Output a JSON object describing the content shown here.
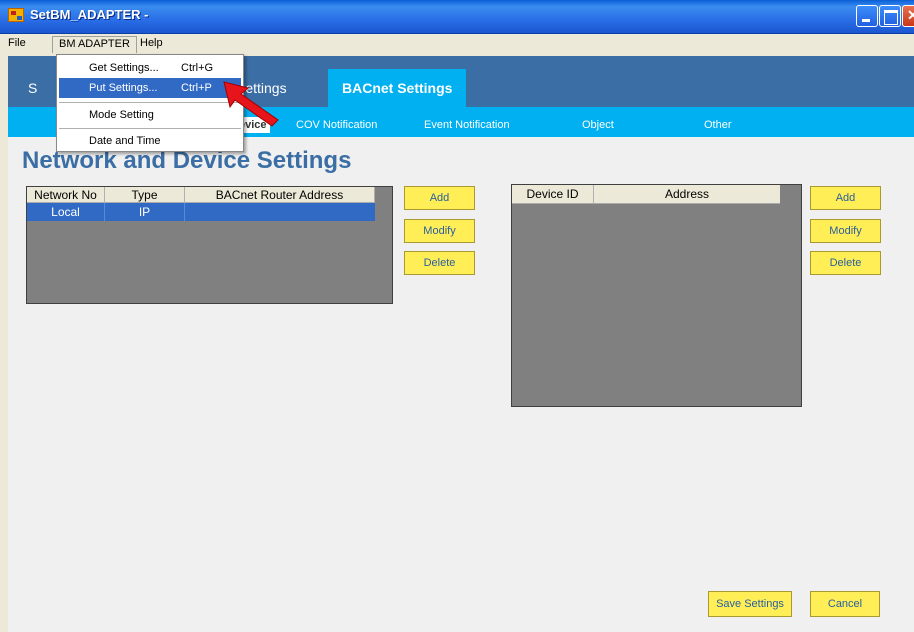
{
  "window": {
    "title": "SetBM_ADAPTER -"
  },
  "menubar": {
    "file": "File",
    "bm_adapter": "BM ADAPTER",
    "help": "Help"
  },
  "dropdown": {
    "items": [
      {
        "label": "Get Settings...",
        "shortcut": "Ctrl+G"
      },
      {
        "label": "Put Settings...",
        "shortcut": "Ctrl+P"
      },
      {
        "label": "Mode Setting",
        "shortcut": ""
      },
      {
        "label": "Date and Time",
        "shortcut": ""
      }
    ]
  },
  "tabs": {
    "partial_left": "S",
    "settings": "Settings",
    "bacnet": "BACnet Settings"
  },
  "subtabs": {
    "device": "evice",
    "cov": "COV Notification",
    "event": "Event Notification",
    "object": "Object",
    "other": "Other"
  },
  "page": {
    "title": "Network and Device Settings"
  },
  "network_table": {
    "columns": [
      "Network No",
      "Type",
      "BACnet Router Address"
    ],
    "rows": [
      {
        "network_no": "Local",
        "type": "IP",
        "router_address": ""
      }
    ]
  },
  "device_table": {
    "columns": [
      "Device ID",
      "Address"
    ]
  },
  "buttons": {
    "add": "Add",
    "modify": "Modify",
    "delete": "Delete",
    "save_settings": "Save Settings",
    "cancel": "Cancel"
  },
  "colors": {
    "tab_bar": "#3a6ea5",
    "active_tab": "#00b0f0",
    "button_yellow": "#ffee55",
    "selection": "#316ac5"
  }
}
